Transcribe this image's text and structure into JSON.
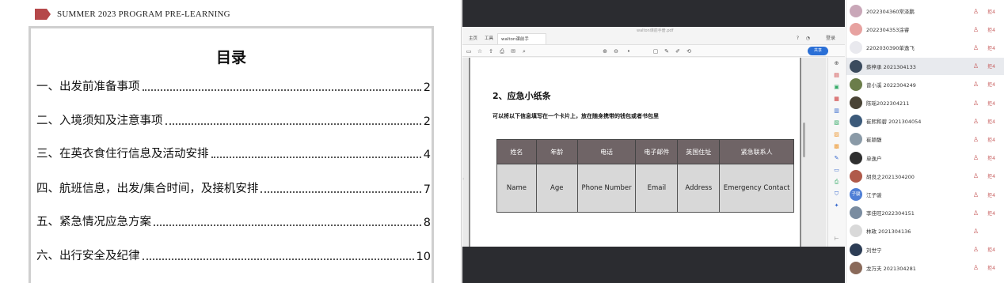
{
  "slide": {
    "header_title": "SUMMER 2023 PROGRAM PRE-LEARNING",
    "toc_heading": "目录",
    "toc": [
      {
        "label": "一、出发前准备事项",
        "page": "2"
      },
      {
        "label": "二、入境须知及注意事项",
        "page": "2"
      },
      {
        "label": "三、在英衣食住行信息及活动安排",
        "page": "4"
      },
      {
        "label": "四、航班信息，出发/集合时间，及接机安排",
        "page": "7"
      },
      {
        "label": "五、紧急情况应急方案",
        "page": "8"
      },
      {
        "label": "六、出行安全及纪律",
        "page": "10"
      }
    ]
  },
  "viewer": {
    "tabs": {
      "home": "主页",
      "tools": "工具",
      "active_doc": "walton课前手册..."
    },
    "doc_title": "walton课前手册.pdf",
    "login": "登录",
    "share": "共享",
    "page_heading": "2、应急小纸条",
    "page_note": "可以将以下信息填写在一个卡片上，放在随身携带的钱包或者书包里",
    "table": {
      "headers": [
        "姓名",
        "年龄",
        "电话",
        "电子邮件",
        "英国住址",
        "紧急联系人"
      ],
      "row": [
        "Name",
        "Age",
        "Phone Number",
        "Email",
        "Address",
        "Emergency Contact"
      ]
    }
  },
  "participants": [
    {
      "name": "2022304360常泽鹏",
      "avatar_color": "#c9a7b8",
      "mic_label": "拒4"
    },
    {
      "name": "2022304353涂睿",
      "avatar_color": "#e7a2a0",
      "mic_label": "拒4"
    },
    {
      "name": "2202030390单逸飞",
      "avatar_color": "#e9e9ee",
      "mic_label": "拒4"
    },
    {
      "name": "蔡梓承 2021304133",
      "avatar_color": "#3b4b5e",
      "mic_label": "拒4"
    },
    {
      "name": "曾小溪 2022304249",
      "avatar_color": "#6b7d4a",
      "mic_label": "拒4"
    },
    {
      "name": "陈瑶2022304211",
      "avatar_color": "#4a4436",
      "mic_label": "拒4"
    },
    {
      "name": "崔熙和碧 2021304054",
      "avatar_color": "#3c5a7a",
      "mic_label": "拒4"
    },
    {
      "name": "崔颖馥",
      "avatar_color": "#8a9aa7",
      "mic_label": "拒4"
    },
    {
      "name": "单逸户",
      "avatar_color": "#2f2f2f",
      "mic_label": "拒4"
    },
    {
      "name": "胡良之2021304200",
      "avatar_color": "#b05a4a",
      "mic_label": "拒4"
    },
    {
      "name": "江子骏",
      "avatar_color": "#4f7fd6",
      "avatar_text": "子骏",
      "mic_label": "拒4"
    },
    {
      "name": "李佳旺2022304151",
      "avatar_color": "#7a8ca0",
      "mic_label": "拒4"
    },
    {
      "name": "林政 2021304136",
      "avatar_color": "#d9d9d9",
      "mic_label": ""
    },
    {
      "name": "刘世宁",
      "avatar_color": "#2d3d55",
      "mic_label": "拒4"
    },
    {
      "name": "龙万夫 2021304281",
      "avatar_color": "#8a6a5a",
      "mic_label": "拒4"
    }
  ]
}
